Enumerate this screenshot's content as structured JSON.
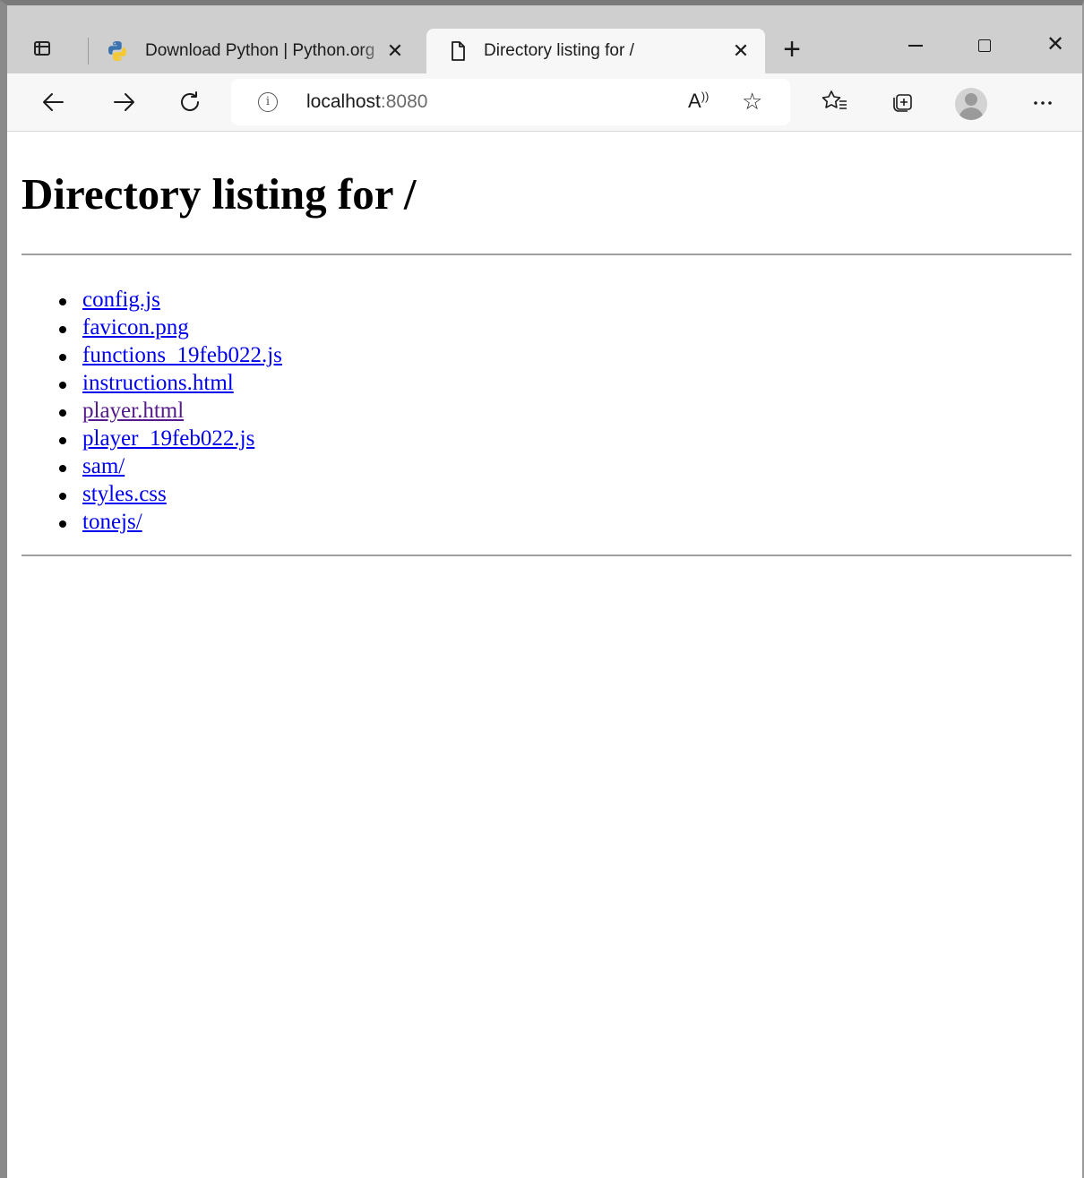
{
  "browser": {
    "tabs": [
      {
        "title": "Download Python | Python.org",
        "icon": "python-icon",
        "active": false
      },
      {
        "title": "Directory listing for /",
        "icon": "document-icon",
        "active": true
      }
    ],
    "new_tab_label": "+",
    "address": {
      "host": "localhost",
      "port": ":8080"
    }
  },
  "page": {
    "heading": "Directory listing for /",
    "files": [
      {
        "name": "config.js",
        "visited": false
      },
      {
        "name": "favicon.png",
        "visited": false
      },
      {
        "name": "functions_19feb022.js",
        "visited": false
      },
      {
        "name": "instructions.html",
        "visited": false
      },
      {
        "name": "player.html",
        "visited": true
      },
      {
        "name": "player_19feb022.js",
        "visited": false
      },
      {
        "name": "sam/",
        "visited": false
      },
      {
        "name": "styles.css",
        "visited": false
      },
      {
        "name": "tonejs/",
        "visited": false
      }
    ]
  },
  "colors": {
    "link": "#0000ee",
    "visited_link": "#551a8b"
  }
}
